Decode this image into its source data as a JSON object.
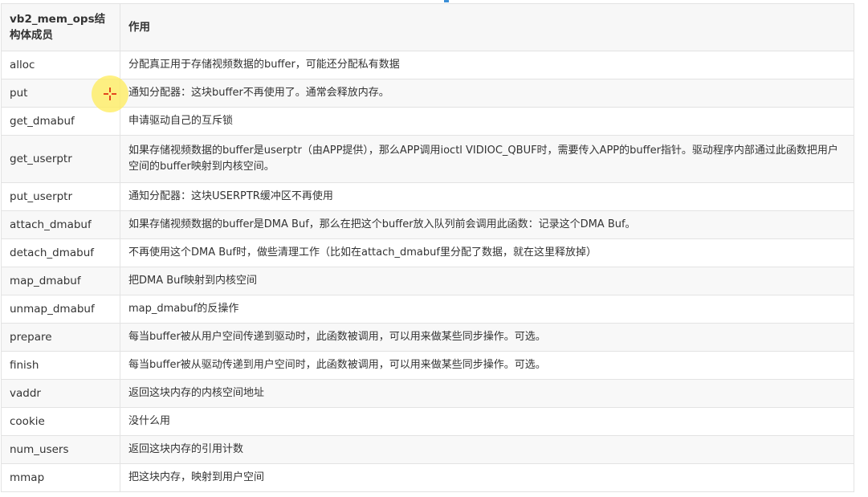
{
  "table": {
    "headers": [
      "vb2_mem_ops结构体成员",
      "作用"
    ],
    "rows": [
      {
        "member": "alloc",
        "desc": "分配真正用于存储视频数据的buffer，可能还分配私有数据"
      },
      {
        "member": "put",
        "desc": "通知分配器：这块buffer不再使用了。通常会释放内存。"
      },
      {
        "member": "get_dmabuf",
        "desc": "申请驱动自己的互斥锁"
      },
      {
        "member": "get_userptr",
        "desc": "如果存储视频数据的buffer是userptr（由APP提供），那么APP调用ioctl VIDIOC_QBUF时，需要传入APP的buffer指针。驱动程序内部通过此函数把用户空间的buffer映射到内核空间。"
      },
      {
        "member": "put_userptr",
        "desc": "通知分配器：这块USERPTR缓冲区不再使用"
      },
      {
        "member": "attach_dmabuf",
        "desc": "如果存储视频数据的buffer是DMA Buf，那么在把这个buffer放入队列前会调用此函数：记录这个DMA Buf。"
      },
      {
        "member": "detach_dmabuf",
        "desc": "不再使用这个DMA Buf时，做些清理工作（比如在attach_dmabuf里分配了数据，就在这里释放掉）"
      },
      {
        "member": "map_dmabuf",
        "desc": "把DMA Buf映射到内核空间"
      },
      {
        "member": "unmap_dmabuf",
        "desc": "map_dmabuf的反操作"
      },
      {
        "member": "prepare",
        "desc": "每当buffer被从用户空间传递到驱动时，此函数被调用，可以用来做某些同步操作。可选。"
      },
      {
        "member": "finish",
        "desc": "每当buffer被从驱动传递到用户空间时，此函数被调用，可以用来做某些同步操作。可选。"
      },
      {
        "member": "vaddr",
        "desc": "返回这块内存的内核空间地址"
      },
      {
        "member": "cookie",
        "desc": "没什么用"
      },
      {
        "member": "num_users",
        "desc": "返回这块内存的引用计数"
      },
      {
        "member": "mmap",
        "desc": "把这块内存，映射到用户空间"
      }
    ]
  },
  "icons": {
    "cursor": "crosshair-cursor-icon"
  },
  "colors": {
    "header_bg": "#f7f7f7",
    "border": "#e3e3e3",
    "text": "#333333",
    "cursor": "#e2461e",
    "halo": "#ffec5a"
  }
}
